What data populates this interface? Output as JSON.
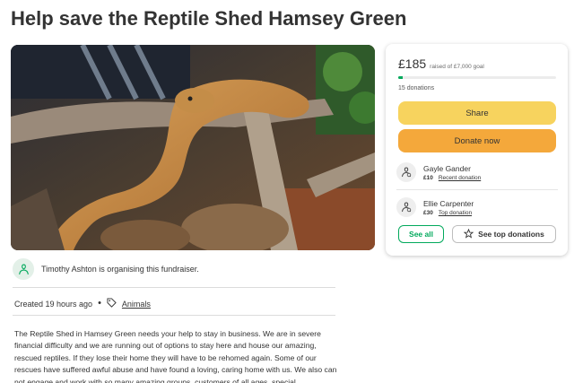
{
  "page": {
    "title": "Help save the Reptile Shed Hamsey Green"
  },
  "photo": {
    "icon": "snake-photo"
  },
  "donation_card": {
    "amount_raised": "£185",
    "goal_text": "raised of £7,000 goal",
    "progress_fraction": 0.026,
    "donations_count": "15 donations",
    "share_label": "Share",
    "donate_label": "Donate now",
    "donors": [
      {
        "name": "Gayle Gander",
        "amount": "£10",
        "tag": "Recent donation"
      },
      {
        "name": "Ellie Carpenter",
        "amount": "£30",
        "tag": "Top donation"
      }
    ],
    "see_all_label": "See all",
    "see_top_label": "See top donations",
    "colors": {
      "green": "#02a95c",
      "share": "#f7d35e",
      "donate": "#f4a83b"
    }
  },
  "organiser": {
    "text": "Timothy Ashton is organising this fundraiser."
  },
  "meta": {
    "created": "Created 19 hours ago",
    "separator": "•",
    "category": "Animals"
  },
  "story": {
    "text": "The Reptile Shed in Hamsey Green needs your help to stay in business. We are in severe financial difficulty and we are running out of options to stay here and house our amazing, rescued reptiles. If they lose their home they will have to be rehomed again. Some of our rescues have suffered awful abuse and have found a loving, caring home with us. We also can not engage and work with so many amazing groups, customers of all ages, special"
  }
}
